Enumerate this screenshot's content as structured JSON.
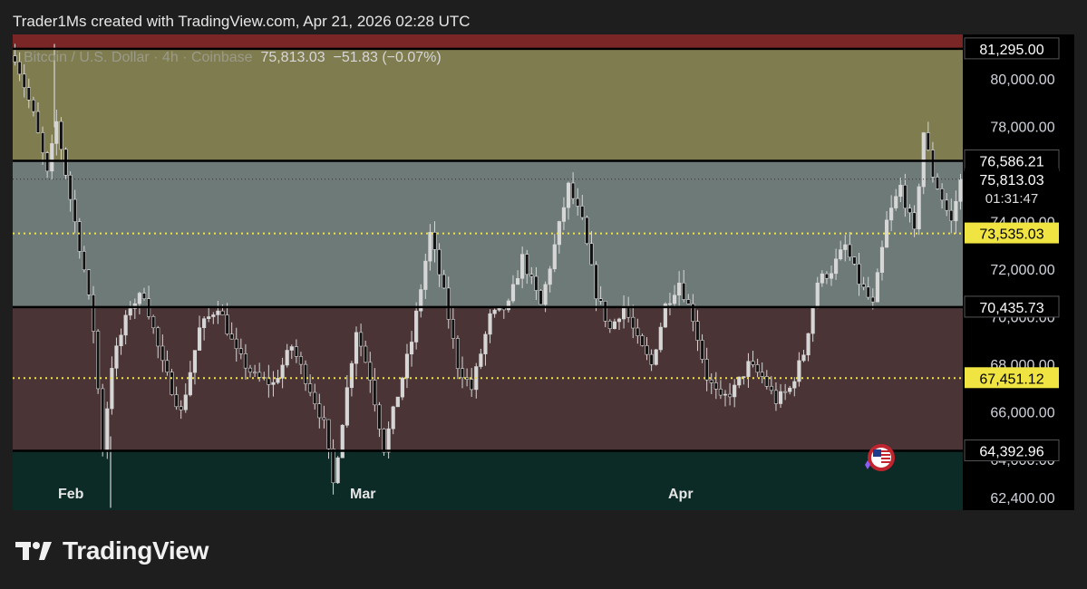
{
  "header": {
    "text": "Trader1Ms created with TradingView.com, Apr 21, 2026 02:28 UTC"
  },
  "legend": {
    "symbol": "Bitcoin / U.S. Dollar · 4h · Coinbase",
    "last": "75,813.03",
    "change": "−51.83 (−0.07%)"
  },
  "footer": {
    "brand": "TradingView"
  },
  "colors": {
    "zone_top": "#7f7c4f",
    "zone_mid_upper": "#6e7a78",
    "zone_mid_lower": "#4a3436",
    "zone_bottom": "#0c2a26",
    "top_band": "#7a2626",
    "level_line": "#000000",
    "dotted_level": "#f0e442",
    "candle": "#d6d6d6"
  },
  "chart_data": {
    "type": "candlestick",
    "symbol": "Bitcoin / U.S. Dollar",
    "timeframe": "4h",
    "exchange": "Coinbase",
    "price_axis_ticks": [
      80000.0,
      78000.0,
      74000.0,
      72000.0,
      70000.0,
      68000.0,
      66000.0,
      64000.0,
      62400.0
    ],
    "price_axis_labels": [
      "80,000.00",
      "78,000.00",
      "74,000.00",
      "72,000.00",
      "70,000.00",
      "68,000.00",
      "66,000.00",
      "64,000.00",
      "62,400.00"
    ],
    "x_labels": [
      "Feb",
      "Mar",
      "Apr"
    ],
    "levels": [
      {
        "price": 81295.0,
        "label": "81,295.00",
        "style": "solid"
      },
      {
        "price": 76586.21,
        "label": "76,586.21",
        "style": "solid"
      },
      {
        "price": 73535.03,
        "label": "73,535.03",
        "style": "dotted"
      },
      {
        "price": 70435.73,
        "label": "70,435.73",
        "style": "solid"
      },
      {
        "price": 67451.12,
        "label": "67,451.12",
        "style": "dotted"
      },
      {
        "price": 64392.96,
        "label": "64,392.96",
        "style": "solid"
      }
    ],
    "current_price": {
      "price": 75813.03,
      "label": "75,813.03",
      "countdown": "01:31:47"
    },
    "ylim": [
      61900,
      81900
    ],
    "path_anchors": [
      [
        0,
        81000
      ],
      [
        4,
        78500
      ],
      [
        7,
        76000
      ],
      [
        9,
        78200
      ],
      [
        12,
        75000
      ],
      [
        15,
        72000
      ],
      [
        17,
        69500
      ],
      [
        19,
        64500
      ],
      [
        21,
        68000
      ],
      [
        25,
        70500
      ],
      [
        28,
        71000
      ],
      [
        32,
        68000
      ],
      [
        36,
        66000
      ],
      [
        40,
        69500
      ],
      [
        44,
        70500
      ],
      [
        48,
        68500
      ],
      [
        52,
        67500
      ],
      [
        56,
        67200
      ],
      [
        60,
        68800
      ],
      [
        64,
        67000
      ],
      [
        67,
        65500
      ],
      [
        69,
        63000
      ],
      [
        72,
        67000
      ],
      [
        74,
        69500
      ],
      [
        77,
        67500
      ],
      [
        80,
        64500
      ],
      [
        82,
        66000
      ],
      [
        86,
        69000
      ],
      [
        90,
        73500
      ],
      [
        93,
        71000
      ],
      [
        96,
        68000
      ],
      [
        99,
        67000
      ],
      [
        103,
        70000
      ],
      [
        107,
        70500
      ],
      [
        110,
        72500
      ],
      [
        114,
        70500
      ],
      [
        117,
        73000
      ],
      [
        120,
        75500
      ],
      [
        123,
        74000
      ],
      [
        126,
        71000
      ],
      [
        129,
        69500
      ],
      [
        132,
        70500
      ],
      [
        135,
        69000
      ],
      [
        138,
        68000
      ],
      [
        141,
        70500
      ],
      [
        144,
        71500
      ],
      [
        147,
        70000
      ],
      [
        150,
        67500
      ],
      [
        153,
        66500
      ],
      [
        156,
        67000
      ],
      [
        159,
        68000
      ],
      [
        162,
        67500
      ],
      [
        165,
        66500
      ],
      [
        168,
        67000
      ],
      [
        171,
        68500
      ],
      [
        174,
        71500
      ],
      [
        177,
        72000
      ],
      [
        180,
        73000
      ],
      [
        183,
        71500
      ],
      [
        186,
        70500
      ],
      [
        189,
        74000
      ],
      [
        192,
        75500
      ],
      [
        195,
        73500
      ],
      [
        197,
        77800
      ],
      [
        199,
        76000
      ],
      [
        201,
        75000
      ],
      [
        203,
        74000
      ],
      [
        205,
        75800
      ]
    ]
  }
}
